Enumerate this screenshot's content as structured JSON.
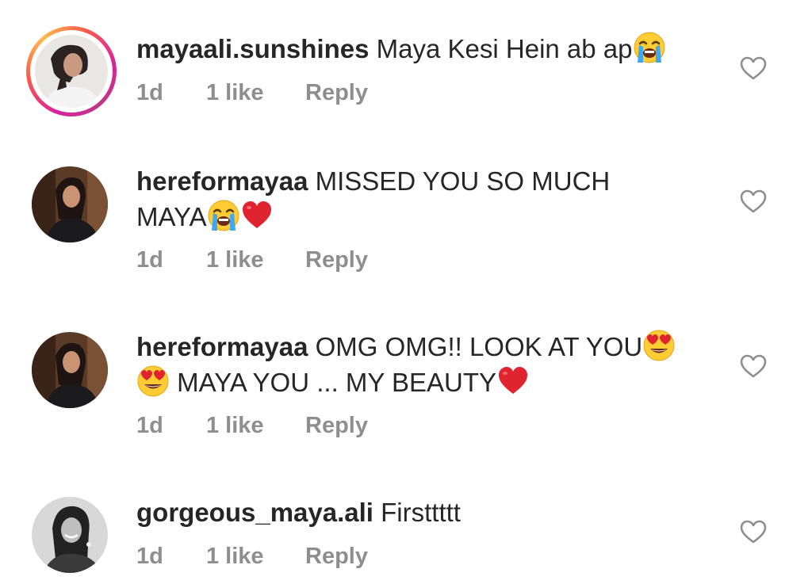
{
  "comments": [
    {
      "username": "mayaali.sunshines",
      "text": "Maya Kesi Hein ab ap",
      "emojis": [
        "loudly-crying-face-emoji"
      ],
      "time": "1d",
      "likes": "1 like",
      "reply_label": "Reply",
      "avatar": "profile-photo-with-story-ring"
    },
    {
      "username": "hereformayaa",
      "text_line1": "MISSED YOU SO MUCH",
      "text_line2": "MAYA",
      "emojis": [
        "loudly-crying-face-emoji",
        "red-heart-emoji"
      ],
      "time": "1d",
      "likes": "1 like",
      "reply_label": "Reply",
      "avatar": "profile-photo"
    },
    {
      "username": "hereformayaa",
      "text_line1": "OMG OMG!! LOOK AT YOU",
      "text_line2": "MAYA YOU ... MY BEAUTY",
      "emojis": [
        "heart-eyes-emoji",
        "heart-eyes-emoji",
        "red-heart-emoji"
      ],
      "time": "1d",
      "likes": "1 like",
      "reply_label": "Reply",
      "avatar": "profile-photo"
    },
    {
      "username": "gorgeous_maya.ali",
      "text": "Firsttttt",
      "time": "1d",
      "likes": "1 like",
      "reply_label": "Reply",
      "avatar": "profile-photo-grayscale"
    }
  ],
  "icons": {
    "like": "heart-outline-icon"
  },
  "colors": {
    "text": "#262626",
    "meta": "#8e8e8e",
    "heart_outline": "#8e8e8e",
    "red_heart": "#e0242f",
    "story_ring_start": "#fdbb4f",
    "story_ring_end": "#d6249f"
  }
}
